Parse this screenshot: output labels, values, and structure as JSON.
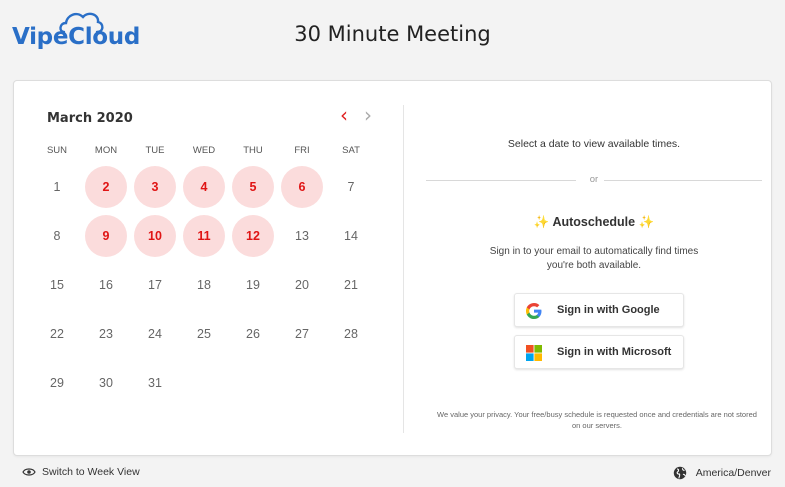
{
  "header": {
    "brand": "VipeCloud",
    "title": "30 Minute Meeting"
  },
  "calendar": {
    "month": "March 2020",
    "prev_icon": "‹",
    "next_icon": "›",
    "weekdays": [
      "SUN",
      "MON",
      "TUE",
      "WED",
      "THU",
      "FRI",
      "SAT"
    ],
    "weeks": [
      [
        {
          "d": "1",
          "avail": false
        },
        {
          "d": "2",
          "avail": true
        },
        {
          "d": "3",
          "avail": true
        },
        {
          "d": "4",
          "avail": true
        },
        {
          "d": "5",
          "avail": true
        },
        {
          "d": "6",
          "avail": true
        },
        {
          "d": "7",
          "avail": false
        }
      ],
      [
        {
          "d": "8",
          "avail": false
        },
        {
          "d": "9",
          "avail": true
        },
        {
          "d": "10",
          "avail": true
        },
        {
          "d": "11",
          "avail": true
        },
        {
          "d": "12",
          "avail": true
        },
        {
          "d": "13",
          "avail": false
        },
        {
          "d": "14",
          "avail": false
        }
      ],
      [
        {
          "d": "15",
          "avail": false
        },
        {
          "d": "16",
          "avail": false
        },
        {
          "d": "17",
          "avail": false
        },
        {
          "d": "18",
          "avail": false
        },
        {
          "d": "19",
          "avail": false
        },
        {
          "d": "20",
          "avail": false
        },
        {
          "d": "21",
          "avail": false
        }
      ],
      [
        {
          "d": "22",
          "avail": false
        },
        {
          "d": "23",
          "avail": false
        },
        {
          "d": "24",
          "avail": false
        },
        {
          "d": "25",
          "avail": false
        },
        {
          "d": "26",
          "avail": false
        },
        {
          "d": "27",
          "avail": false
        },
        {
          "d": "28",
          "avail": false
        }
      ],
      [
        {
          "d": "29",
          "avail": false
        },
        {
          "d": "30",
          "avail": false
        },
        {
          "d": "31",
          "avail": false
        }
      ]
    ]
  },
  "panel": {
    "select_prompt": "Select a date to view available times.",
    "or_label": "or",
    "autoschedule_title": "Autoschedule",
    "sparkle": "✨",
    "autoschedule_desc": "Sign in to your email to automatically find times you're both available.",
    "google_button": "Sign in with Google",
    "microsoft_button": "Sign in with Microsoft",
    "privacy_note": "We value your privacy. Your free/busy schedule is requested once and credentials are not stored on our servers."
  },
  "footer": {
    "week_view": "Switch to Week View",
    "timezone": "America/Denver"
  },
  "colors": {
    "brand_blue": "#2a6fc7",
    "accent_red": "#e01515",
    "available_bg": "#fbdcdc"
  }
}
